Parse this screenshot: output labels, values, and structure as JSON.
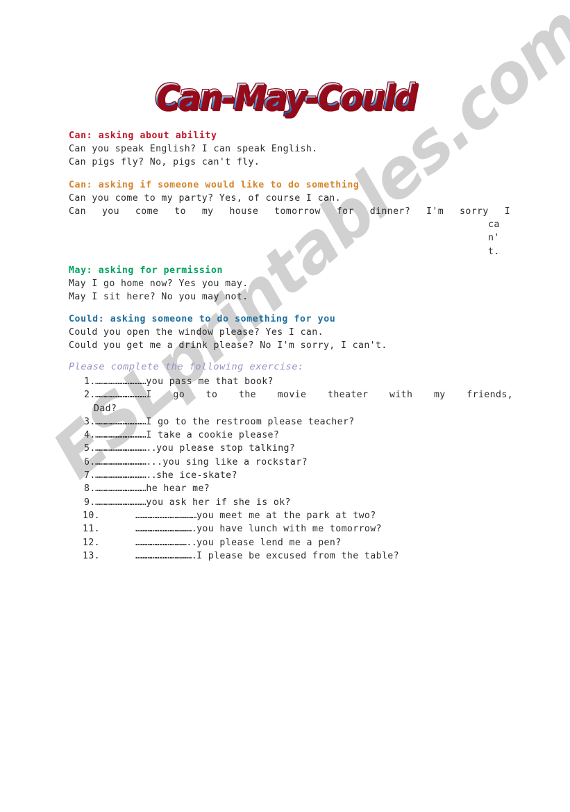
{
  "document": {
    "title": "Can-May-Could",
    "colors": {
      "can_ability": "#C0152A",
      "can_invite": "#D4842C",
      "may_permission": "#00A45E",
      "could_request": "#1C6F9E",
      "instruction": "#9D90C6",
      "body": "#2b2b2b",
      "watermark": "#cfcfcf"
    }
  },
  "watermark": {
    "text": "ESLprintables.com"
  },
  "sections": [
    {
      "heading": "Can: asking about ability",
      "lines": [
        "Can you speak English? I can speak English.",
        "Can pigs fly? No, pigs can't fly."
      ]
    },
    {
      "heading": "Can: asking if someone would like to do something",
      "lines": [
        "Can you come to my party? Yes, of course I can.",
        "Can you come to my house tomorrow for dinner? I'm sorry I"
      ],
      "overflow_fragments": [
        "ca",
        "n'",
        "t."
      ]
    },
    {
      "heading": "May: asking for permission",
      "lines": [
        "May I go home now? Yes you may.",
        "May I sit here? No you may not."
      ]
    },
    {
      "heading": "Could: asking someone to do something for you",
      "lines": [
        "Could you open the window please? Yes I can.",
        "Could you get me a drink please? No I'm sorry, I can't."
      ]
    }
  ],
  "instruction": "Please complete the following exercise:",
  "exercise": {
    "items": [
      {
        "number": "1.",
        "blank": "…………………………",
        "text": " you pass me that book?"
      },
      {
        "number": "2.",
        "blank": "…………………………",
        "text": " I go to the movie theater with my friends,",
        "continuation": "Dad?"
      },
      {
        "number": "3.",
        "blank": "…………………………",
        "text": " I go to the restroom please teacher?"
      },
      {
        "number": "4.",
        "blank": "…………………………",
        "text": " I take a cookie please?"
      },
      {
        "number": "5.",
        "blank": "…………………………..",
        "text": " you please stop talking?"
      },
      {
        "number": "6.",
        "blank": "………………………….",
        "text": " ..you sing like a rockstar?"
      },
      {
        "number": "7.",
        "blank": "…………………………..",
        "text": " she ice-skate?"
      },
      {
        "number": "8.",
        "blank": "…………………………",
        "text": " he hear me?"
      },
      {
        "number": "9.",
        "blank": "…………………………",
        "text": " you ask her if she is ok?"
      },
      {
        "number": "10.",
        "blank": "………………………………",
        "text": "you meet me at the park at two?"
      },
      {
        "number": "11.",
        "blank": "…………………………….",
        "text": " you have lunch with me tomorrow?"
      },
      {
        "number": "12.",
        "blank": "…………………………..",
        "text": " you please lend me a pen?"
      },
      {
        "number": "13.",
        "blank": "…………………………….",
        "text": " I please be excused from the table?"
      }
    ]
  }
}
